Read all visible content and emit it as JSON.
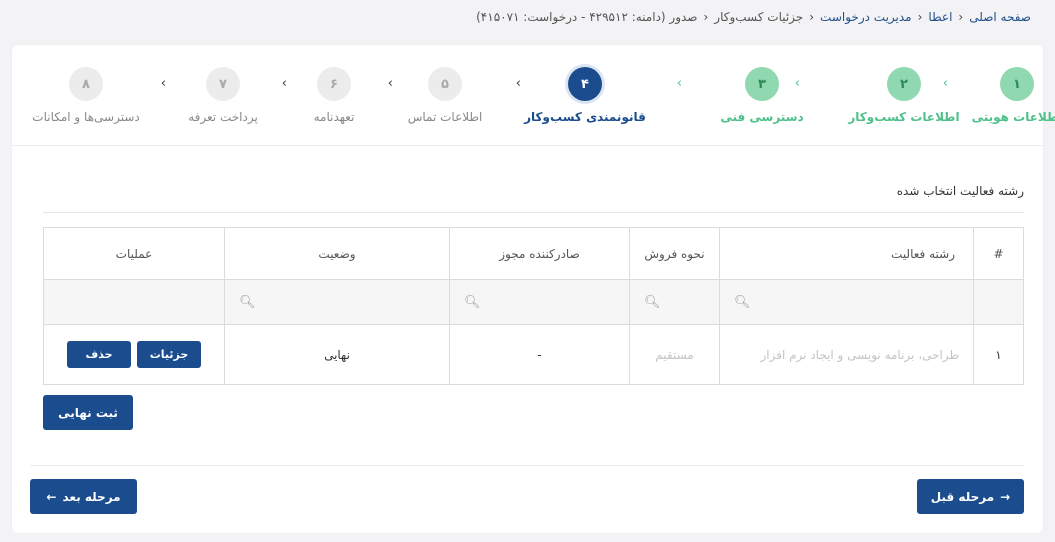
{
  "breadcrumb": {
    "items": [
      "صفحه اصلی",
      "اعطا",
      "مدیریت درخواست",
      "جزئیات کسب‌وکار"
    ],
    "current": "صدور (دامنه: ۴۲۹۵۱۲ - درخواست: ۴۱۵۰۷۱)"
  },
  "stepper": {
    "steps": [
      {
        "num": "۱",
        "label": "اطلاعات هویتی",
        "state": "done"
      },
      {
        "num": "۲",
        "label": "اطلاعات کسب‌وکار",
        "state": "done"
      },
      {
        "num": "۳",
        "label": "دسترسی فنی",
        "state": "done"
      },
      {
        "num": "۴",
        "label": "قانونمندی کسب‌وکار",
        "state": "active"
      },
      {
        "num": "۵",
        "label": "اطلاعات تماس",
        "state": "pending"
      },
      {
        "num": "۶",
        "label": "تعهدنامه",
        "state": "pending"
      },
      {
        "num": "۷",
        "label": "پرداخت تعرفه",
        "state": "pending"
      },
      {
        "num": "۸",
        "label": "دسترسی‌ها و امکانات",
        "state": "pending"
      }
    ]
  },
  "section": {
    "title": "رشته فعالیت انتخاب شده"
  },
  "table": {
    "headers": {
      "index": "#",
      "field": "رشته فعالیت",
      "sale": "نحوه فروش",
      "issuer": "صادرکننده مجوز",
      "status": "وضعیت",
      "ops": "عملیات"
    },
    "rows": [
      {
        "index": "۱",
        "field": "طراحی، برنامه نویسی و ایجاد نرم افزار",
        "sale": "مستقیم",
        "issuer": "-",
        "status": "نهایی"
      }
    ],
    "row_buttons": {
      "details": "جزئیات",
      "delete": "حذف"
    }
  },
  "buttons": {
    "final_submit": "ثبت نهایی",
    "prev": "مرحله قبل",
    "next": "مرحله بعد",
    "prev_arrow": "→",
    "next_arrow": "←"
  },
  "colors": {
    "primary": "#1b4c8e",
    "done": "#4ec08a",
    "pending": "#ececec"
  }
}
